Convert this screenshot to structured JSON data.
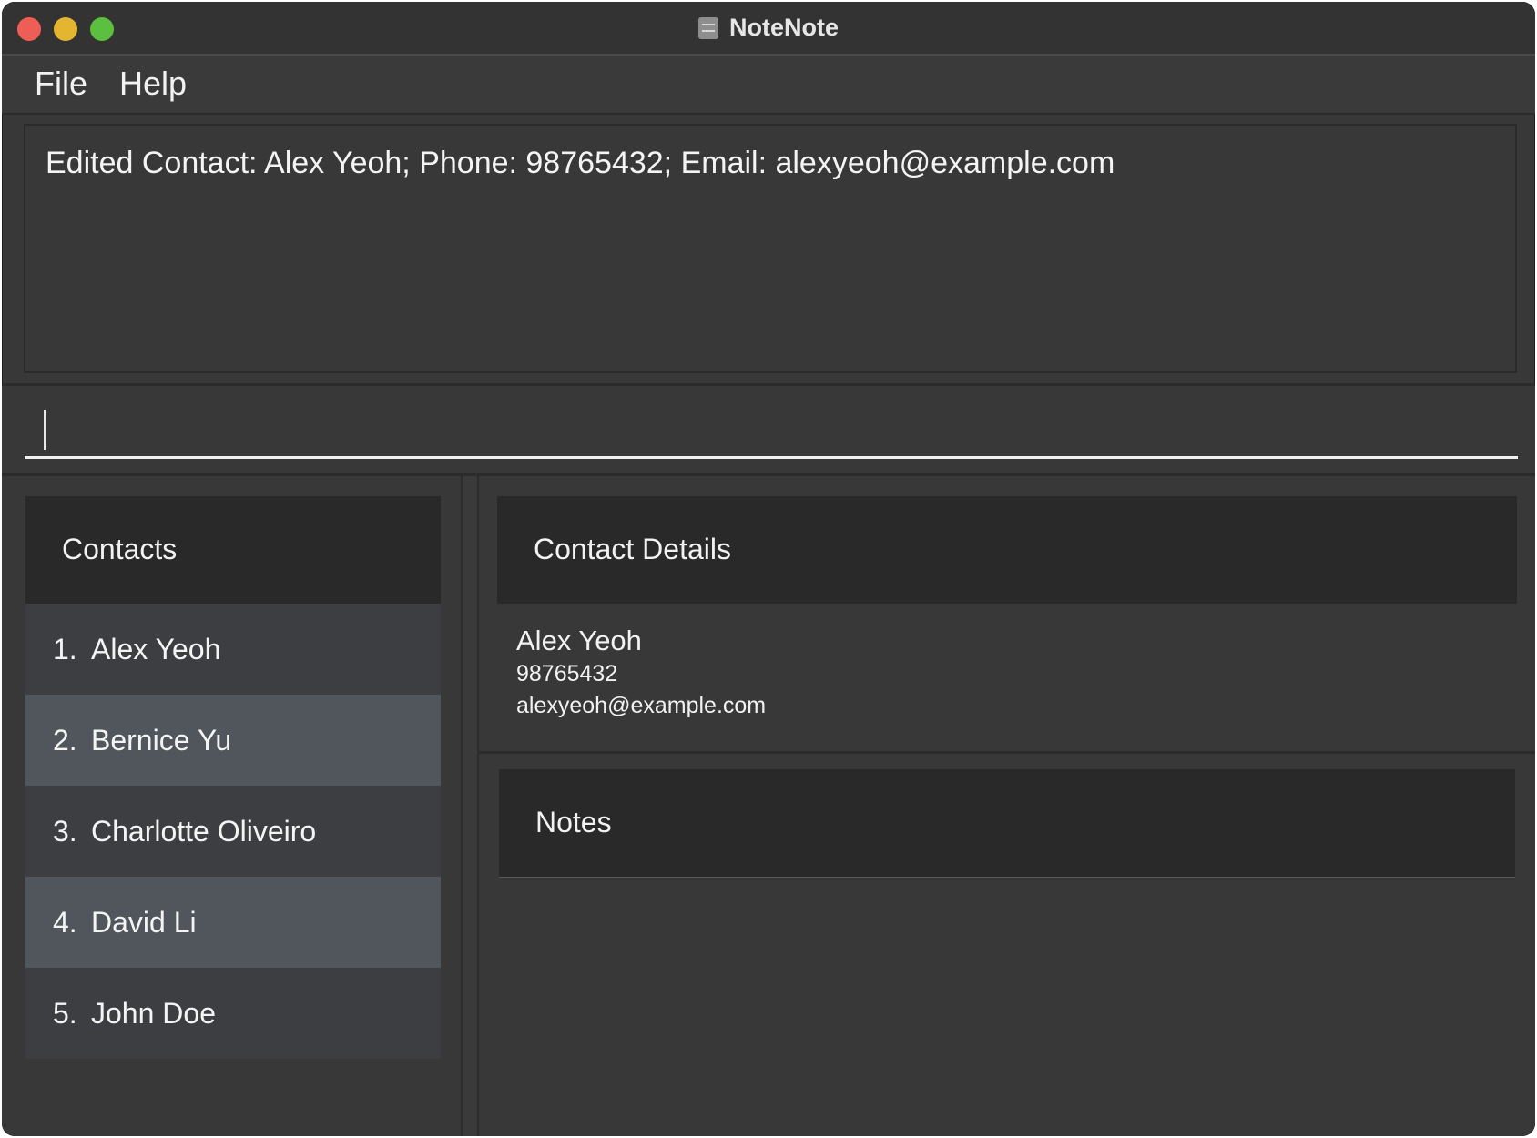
{
  "window": {
    "title": "NoteNote"
  },
  "menu": {
    "file": "File",
    "help": "Help"
  },
  "result": {
    "text": "Edited Contact: Alex Yeoh; Phone: 98765432; Email: alexyeoh@example.com"
  },
  "command": {
    "value": ""
  },
  "contacts": {
    "heading": "Contacts",
    "items": [
      {
        "index": "1.",
        "name": "Alex Yeoh"
      },
      {
        "index": "2.",
        "name": "Bernice Yu"
      },
      {
        "index": "3.",
        "name": "Charlotte Oliveiro"
      },
      {
        "index": "4.",
        "name": "David Li"
      },
      {
        "index": "5.",
        "name": "John Doe"
      }
    ]
  },
  "details": {
    "heading": "Contact Details",
    "name": "Alex Yeoh",
    "phone": "98765432",
    "email": "alexyeoh@example.com"
  },
  "notes": {
    "heading": "Notes"
  }
}
